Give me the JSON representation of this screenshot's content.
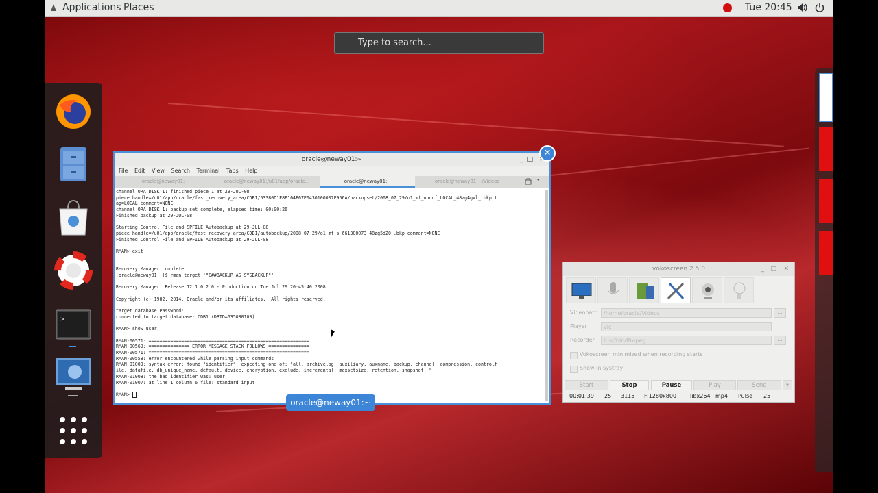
{
  "topbar": {
    "applications": "Applications",
    "places": "Places",
    "clock": "Tue 20:45"
  },
  "search": {
    "placeholder": "Type to search..."
  },
  "dock": {
    "items": [
      "firefox-icon",
      "files-icon",
      "software-icon",
      "help-icon",
      "terminal-icon",
      "screenshot-icon",
      "app-grid-icon"
    ]
  },
  "terminal": {
    "title": "oracle@neway01:~",
    "menu": [
      "File",
      "Edit",
      "View",
      "Search",
      "Terminal",
      "Tabs",
      "Help"
    ],
    "tabs": [
      "oracle@neway01:~",
      "oracle@neway01:/u01/app/oracle...",
      "oracle@neway01:~",
      "oracle@neway01:~/Videos"
    ],
    "active_tab": 2,
    "lines": [
      "channel ORA_DISK_1: finished piece 1 at 29-JUL-08",
      "piece handle=/u01/app/oracle/fast_recovery_area/CDB1/53380D1F8E164F67E0430100007F956A/backupset/2008_07_29/o1_mf_nnndf_LOCAL_48zg4gvl_.bkp t",
      "ag=LOCAL comment=NONE",
      "channel ORA_DISK_1: backup set complete, elapsed time: 00:00:26",
      "Finished backup at 29-JUL-08",
      "",
      "Starting Control File and SPFILE Autobackup at 29-JUL-08",
      "piece handle=/u01/app/oracle/fast_recovery_area/CDB1/autobackup/2008_07_29/o1_mf_s_661300073_48zg5d20_.bkp comment=NONE",
      "Finished Control File and SPFILE Autobackup at 29-JUL-08",
      "",
      "RMAN> exit",
      "",
      "",
      "Recovery Manager complete.",
      "[oracle@neway01 ~]$ rman target '\"C##BACKUP AS SYSBACKUP\"'",
      "",
      "Recovery Manager: Release 12.1.0.2.0 - Production on Tue Jul 29 20:45:40 2008",
      "",
      "Copyright (c) 1982, 2014, Oracle and/or its affiliates.  All rights reserved.",
      "",
      "target database Password:",
      "connected to target database: CDB1 (DBID=635080100)",
      "",
      "RMAN> show user;",
      "",
      "RMAN-00571: ===========================================================",
      "RMAN-00569: =============== ERROR MESSAGE STACK FOLLOWS ===============",
      "RMAN-00571: ===========================================================",
      "RMAN-00558: error encountered while parsing input commands",
      "RMAN-01009: syntax error: found \"identifier\": expecting one of: \"all, archivelog, auxiliary, auxname, backup, channel, compression, controlf",
      "ile, datafile, db_unique_name, default, device, encryption, exclude, incremental, maxsetsize, retention, snapshot, \"",
      "RMAN-01008: the bad identifier was: user",
      "RMAN-01007: at line 1 column 6 file: standard input",
      "",
      "RMAN> "
    ]
  },
  "window_label": "oracle@neway01:~",
  "vokoscreen": {
    "title": "vokoscreen 2.5.0",
    "fields": [
      {
        "label": "Videopath",
        "value": "/home/oracle/Videos"
      },
      {
        "label": "Player",
        "value": "vlc"
      },
      {
        "label": "Recorder",
        "value": "/usr/bin/ffmpeg"
      }
    ],
    "checkboxes": [
      "Vokoscreen minimized when recording starts",
      "Show in systray"
    ],
    "buttons": [
      "Start",
      "Stop",
      "Pause",
      "Play",
      "Send"
    ],
    "status": {
      "time": "00:01:39",
      "fps": "25",
      "frames": "3115",
      "format": "F:1280x800",
      "codec": "libx264",
      "container": "mp4",
      "audio": "Pulse",
      "audio_val": "25"
    }
  }
}
